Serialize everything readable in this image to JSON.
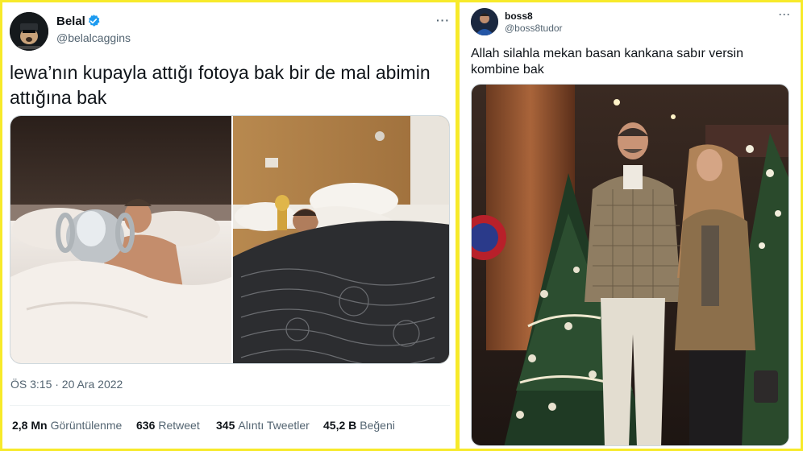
{
  "left_tweet": {
    "author": {
      "display_name": "Belal",
      "handle": "@belalcaggins",
      "verified": true
    },
    "more_label": "···",
    "text": "lewa’nın kupayla attığı fotoya bak bir de mal abimin attığına bak",
    "media": [
      {
        "description_icon": "photo-icon"
      },
      {
        "description_icon": "photo-icon"
      }
    ],
    "timestamp": "ÖS 3:15 · 20 Ara 2022",
    "stats": {
      "views": {
        "value": "2,8 Mn",
        "label": "Görüntülenme"
      },
      "retweets": {
        "value": "636",
        "label": "Retweet"
      },
      "quotes": {
        "value": "345",
        "label": "Alıntı Tweetler"
      },
      "likes": {
        "value": "45,2 B",
        "label": "Beğeni"
      }
    }
  },
  "right_tweet": {
    "author": {
      "display_name": "boss8",
      "handle": "@boss8tudor"
    },
    "more_label": "···",
    "text": "Allah silahla mekan basan kankana sabır versin kombine bak"
  },
  "colors": {
    "background_frame": "#f7ea2a",
    "text_primary": "#0f1419",
    "text_secondary": "#536471",
    "verified_blue": "#1d9bf0"
  }
}
